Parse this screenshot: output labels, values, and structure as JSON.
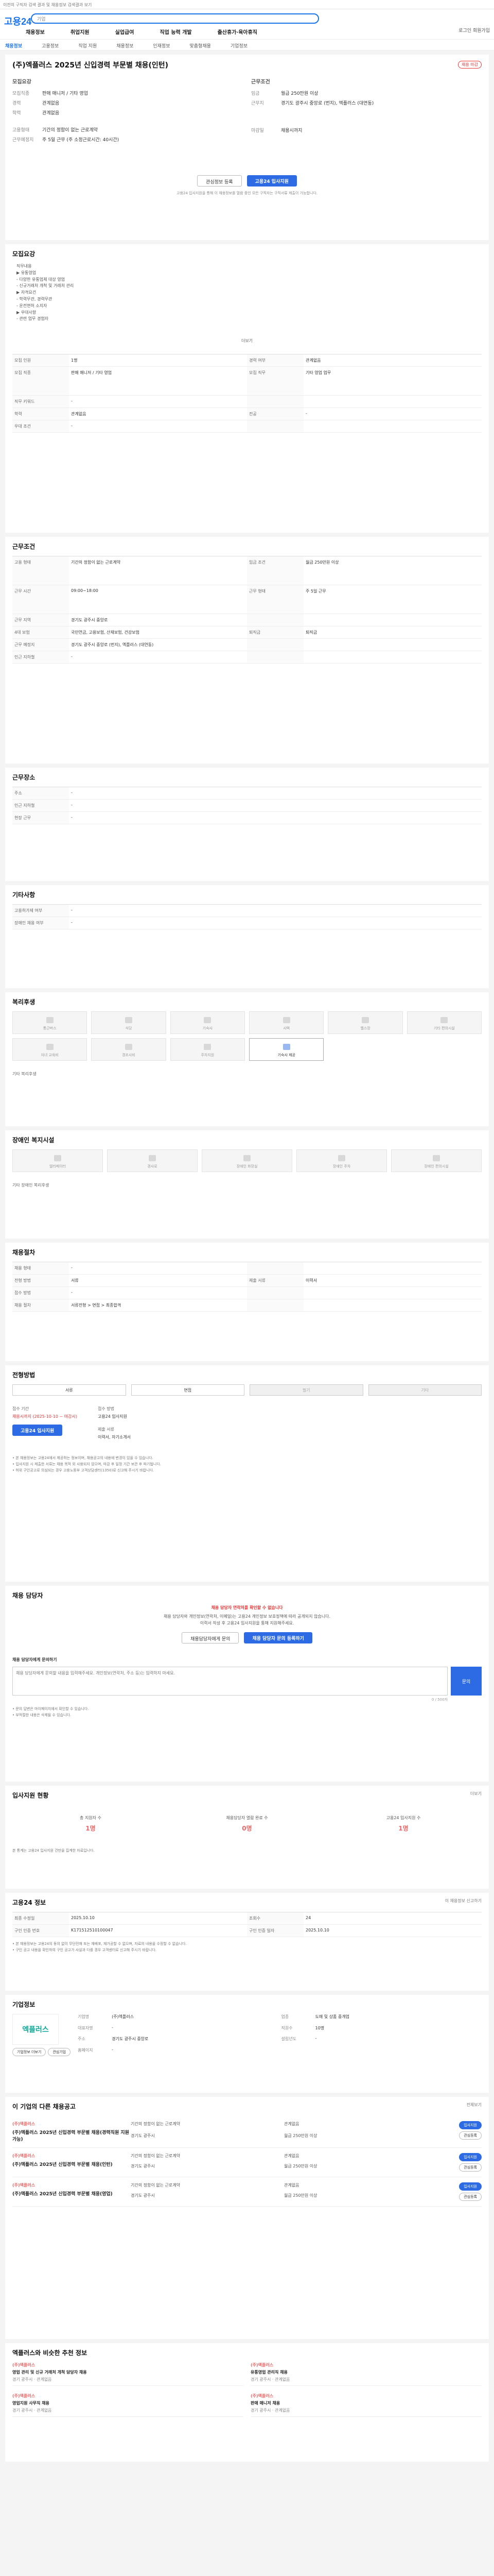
{
  "topbar": {
    "text": "이전의 구직자 검색 결과 및 채용정보 검색결과 보기"
  },
  "header": {
    "logo": "고용24",
    "search_placeholder": "기업",
    "right_text": "로그인  회원가입"
  },
  "nav": [
    "채용정보",
    "취업지원",
    "실업급여",
    "직업 능력 개발",
    "출산휴가·육아휴직"
  ],
  "breadcrumb": [
    "채용정보",
    "고용정보",
    "직업 지원",
    "채용정보",
    "인재정보",
    "맞춤형채용",
    "기업정보"
  ],
  "job": {
    "title": "(주)엑플러스 2025년 신입경력 부문별 채용(인턴)",
    "badge": "채용 마감",
    "summary_left_title": "모집요강",
    "summary_right_title": "근무조건",
    "left": [
      {
        "k": "모집직종",
        "v": "판매 매니저 / 기타 영업"
      },
      {
        "k": "경력",
        "v": "관계없음"
      },
      {
        "k": "학력",
        "v": "관계없음"
      },
      {
        "k": "고용형태",
        "v": "기간의 정함이 없는 근로계약"
      },
      {
        "k": "근무예정지",
        "v": "주 5일 근무 (주 소정근로시간: 40시간)"
      }
    ],
    "right": [
      {
        "k": "임금",
        "v": "월급 250만원 이상"
      },
      {
        "k": "근무지",
        "v": "경기도 광주시 중앙로 (번지), 엑플러스 (대연동)"
      },
      {
        "k": "",
        "v": ""
      },
      {
        "k": "마감일",
        "v": "채용시까지"
      },
      {
        "k": "",
        "v": ""
      }
    ],
    "btn_save": "관심정보 등록",
    "btn_apply": "고용24 입사지원",
    "note": "고용24 입사지원을 통해 이 채용정보를 열람 중인 모든 구직자는 구직서류 제출이 가능합니다."
  },
  "details": {
    "title": "모집요강",
    "bullets": [
      "직무내용",
      "▶ 유통영업",
      "- 다양한 유통업체 대상 영업",
      "- 신규거래처 개척 및 거래처 관리",
      "▶ 자격요건",
      "- 학력무관, 경력무관",
      "- 운전면허 소지자",
      "▶ 우대사항",
      "- 관련 업무 경험자"
    ],
    "more": "더보기",
    "rows": [
      {
        "k": "모집 인원",
        "v": "1명",
        "k2": "경력 여부",
        "v2": "관계없음"
      },
      {
        "k": "모집 직종",
        "v": "판매 매니저 / 기타 영업",
        "k2": "모집 직무",
        "v2": "기타 영업 업무"
      },
      {
        "k": "직무 키워드",
        "v": "-",
        "k2": "",
        "v2": ""
      },
      {
        "k": "학력",
        "v": "관계없음",
        "k2": "전공",
        "v2": "-"
      },
      {
        "k": "우대 조건",
        "v": "-",
        "k2": "",
        "v2": ""
      }
    ]
  },
  "conditions": {
    "title": "근무조건",
    "rows": [
      {
        "k": "고용 형태",
        "v": "기간의 정함이 없는 근로계약",
        "k2": "임금 조건",
        "v2": "월급 250만원 이상"
      },
      {
        "k": "근무 시간",
        "v": "09:00~18:00",
        "k2": "근무 형태",
        "v2": "주 5일 근무"
      },
      {
        "k": "근무 지역",
        "v": "경기도 광주시 중앙로",
        "k2": "",
        "v2": ""
      },
      {
        "k": "4대 보험",
        "v": "국민연금, 고용보험, 산재보험, 건강보험",
        "k2": "퇴직금",
        "v2": "퇴직금"
      },
      {
        "k": "근무 예정지",
        "v": "경기도 광주시 중앙로 (번지), 엑플러스 (대연동)",
        "k2": "",
        "v2": ""
      },
      {
        "k": "인근 지하철",
        "v": "-",
        "k2": "",
        "v2": ""
      }
    ]
  },
  "employment": {
    "title": "근무장소",
    "rows": [
      {
        "k": "주소",
        "v": "-"
      },
      {
        "k": "인근 지하철",
        "v": "-"
      },
      {
        "k": "현장 근무",
        "v": "-"
      }
    ]
  },
  "other": {
    "title": "기타사항",
    "rows": [
      {
        "k": "고용허가제 여부",
        "v": "-"
      },
      {
        "k": "장애인 채용 여부",
        "v": "-"
      }
    ]
  },
  "facilities": {
    "title": "복리후생",
    "tiles": [
      "통근버스",
      "식당",
      "기숙사",
      "사택",
      "헬스장",
      "기타 편의시설",
      "자녀 교육비",
      "경조사비",
      "주차지원",
      "기숙사 제공"
    ],
    "note": "기타 복리후생"
  },
  "welfare": {
    "title": "장애인 복지시설",
    "tiles": [
      "엘리베이터",
      "경사로",
      "장애인 화장실",
      "장애인 주차",
      "장애인 편의시설"
    ],
    "note": "기타 장애인 복리후생"
  },
  "process": {
    "title": "채용절차",
    "rows": [
      {
        "k": "채용 형태",
        "v": "-",
        "k2": "",
        "v2": ""
      },
      {
        "k": "전형 방법",
        "v": "서류",
        "k2": "제출 서류",
        "v2": "이력서"
      },
      {
        "k": "접수 방법",
        "v": "-",
        "k2": "",
        "v2": ""
      },
      {
        "k": "채용 절차",
        "v": "서류전형 > 면접 > 최종합격",
        "k2": "",
        "v2": ""
      }
    ]
  },
  "apply": {
    "title": "전형방법",
    "methods": [
      "서류",
      "면접",
      "필기",
      "기타"
    ],
    "period_label": "접수 기간",
    "period": "채용시까지 (2025-10-10 ~ 마감시)",
    "method_label": "접수 방법",
    "method_value": "고용24 입사지원",
    "btn": "고용24 입사지원",
    "doc_label": "제출 서류",
    "doc_value": "이력서, 자기소개서",
    "notes": [
      "• 본 채용정보는 고용24에서 제공하는 정보이며, 채용공고의 내용에 변경이 있을 수 있습니다.",
      "• 입사지원 시 제출한 서류는 채용 목적 외 사용되지 않으며, 마감 후 일정 기간 보관 후 파기됩니다.",
      "• 허위 구인공고로 의심되는 경우 고용노동부 고객상담센터(1350)로 신고해 주시기 바랍니다."
    ]
  },
  "contact": {
    "title": "채용 담당자",
    "alert": "채용 담당자 연락처를 확인할 수 없습니다",
    "line1": "채용 담당자와 개인정보(연락처, 이메일)는 고용24 개인정보 보호정책에 따라 공개되지 않습니다.",
    "line2": "이력서 작성 후 고용24 입사지원을 통해 지원해주세요.",
    "btn1": "채용담당자에게 문의",
    "btn2": "채용 담당자 문의 등록하기",
    "q_title": "채용 담당자에게 문의하기",
    "q_hint": "0 / 500자",
    "q_placeholder": "채용 담당자에게 문의할 내용을 입력해주세요. 개인정보(연락처, 주소 등)는 입력하지 마세요.",
    "q_btn": "문의",
    "notes": [
      "• 문의 답변은 마이페이지에서 확인할 수 있습니다.",
      "• 부적절한 내용은 삭제될 수 있습니다."
    ]
  },
  "stats": {
    "title": "입사지원 현황",
    "more": "더보기",
    "items": [
      {
        "lbl": "총 지원자 수",
        "num": "1명"
      },
      {
        "lbl": "채용담당자 열람 완료 수",
        "num": "0명"
      },
      {
        "lbl": "고용24 입사지원 수",
        "num": "1명"
      }
    ],
    "note": "본 통계는 고용24 입사지원 건만을 집계한 자료입니다."
  },
  "info": {
    "title": "고용24 정보",
    "more": "이 채용정보 신고하기",
    "rows": [
      {
        "k": "최종 수정일",
        "v": "2025.10.10",
        "k2": "조회수",
        "v2": "24"
      },
      {
        "k": "구인 인증 번호",
        "v": "K171512510100047",
        "k2": "구인 인증 일자",
        "v2": "2025.10.10"
      }
    ],
    "notes": [
      "• 본 채용정보는 고용24의 동의 없이 무단전재 또는 재배포, 재가공할 수 없으며, 자료의 내용을 수정할 수 없습니다.",
      "• 구인 공고 내용을 확인하여 구인 공고가 사실과 다를 경우 고객센터로 신고해 주시기 바랍니다."
    ]
  },
  "company": {
    "title": "기업정보",
    "logo": "엑플러스",
    "btn_more": "기업정보 더보기",
    "btn_fav": "관심기업",
    "rows": [
      {
        "k": "기업명",
        "v": "(주)엑플러스",
        "k2": "업종",
        "v2": "도매 및 상품 중개업"
      },
      {
        "k": "대표자명",
        "v": "-",
        "k2": "직원수",
        "v2": "10명"
      },
      {
        "k": "주소",
        "v": "경기도 광주시 중앙로",
        "k2": "설립년도",
        "v2": "-"
      },
      {
        "k": "홈페이지",
        "v": "-",
        "k2": "",
        "v2": ""
      }
    ]
  },
  "related": {
    "title": "이 기업의 다른 채용공고",
    "more": "전체보기",
    "jobs": [
      {
        "comp": "(주)엑플러스",
        "title": "(주)엑플러스 2025년 신입경력 부문별 채용(경력직원 지원가능)",
        "meta": [
          "기간의 정함이 없는 근로계약",
          "관계없음",
          "경기도 광주시",
          "월급 250만원 이상"
        ]
      },
      {
        "comp": "(주)엑플러스",
        "title": "(주)엑플러스 2025년 신입경력 부문별 채용(인턴)",
        "meta": [
          "기간의 정함이 없는 근로계약",
          "관계없음",
          "경기도 광주시",
          "월급 250만원 이상"
        ]
      },
      {
        "comp": "(주)엑플러스",
        "title": "(주)엑플러스 2025년 신입경력 부문별 채용(영업)",
        "meta": [
          "기간의 정함이 없는 근로계약",
          "관계없음",
          "경기도 광주시",
          "월급 250만원 이상"
        ]
      }
    ],
    "btn_apply": "입사지원",
    "btn_save": "관심등록"
  },
  "recommended": {
    "title": "엑플러스와 비슷한 추천 정보",
    "items": [
      {
        "comp": "(주)엑플러스",
        "title": "영업 관리 및 신규 거래처 개척 담당자 채용",
        "meta": "경기 광주시 · 관계없음"
      },
      {
        "comp": "(주)엑플러스",
        "title": "유통영업 관리직 채용",
        "meta": "경기 광주시 · 관계없음"
      },
      {
        "comp": "(주)엑플러스",
        "title": "영업지원 사무직 채용",
        "meta": "경기 광주시 · 관계없음"
      },
      {
        "comp": "(주)엑플러스",
        "title": "판매 매니저 채용",
        "meta": "경기 광주시 · 관계없음"
      }
    ]
  }
}
